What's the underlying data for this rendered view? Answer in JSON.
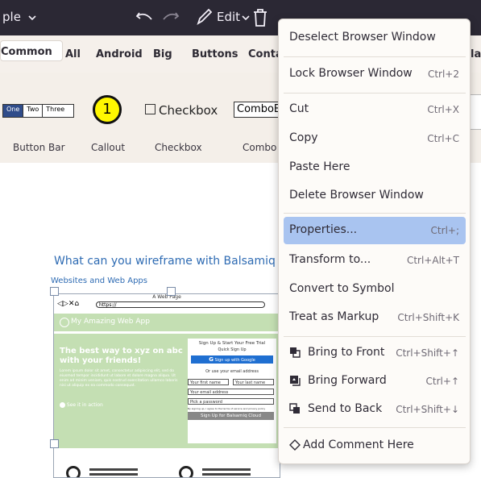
{
  "toolbar": {
    "project_name": "ple",
    "edit_label": "Edit"
  },
  "library_tabs": [
    "Common",
    "All",
    "Android",
    "Big",
    "Buttons",
    "Conta",
    "lar"
  ],
  "components": {
    "button_bar": {
      "label": "Button Bar",
      "segments": [
        "One",
        "Two",
        "Three"
      ]
    },
    "callout": {
      "label": "Callout",
      "number": "1"
    },
    "checkbox": {
      "label": "Checkbox",
      "text": "Checkbox"
    },
    "combo": {
      "label": "Combo",
      "text": "ComboB"
    }
  },
  "canvas": {
    "heading": "What can you wireframe with Balsamiq",
    "subheading": "Websites and Web Apps",
    "mock": {
      "title": "A Web Page",
      "url": "https://",
      "app_name": "My Amazing Web App",
      "hero_title": "The best way to xyz on abc with your friends!",
      "hero_body": "Lorem ipsum dolor sit amet, consectetur adipiscing elit, sed do eiusmod tempor incididunt ut labore et dolore magna aliqua. Ut enim ad minim veniam, quis nostrud exercitation ullamco laboris nisi ut aliquip ex ea commodo consequat.",
      "hero_link": "See it in action",
      "signup_title": "Sign Up & Start Your Free Trial",
      "quick_signup": "Quick Sign Up",
      "google_button": "Sign up with Google",
      "or_email": "Or use your email address",
      "first_name": "Your first name",
      "last_name": "Your last name",
      "email": "Your email address",
      "password": "Pick a password",
      "terms": "By signing up, I agree to the terms of service and privacy policy",
      "submit": "Sign Up for Balsamiq Cloud"
    }
  },
  "context_menu": {
    "deselect": "Deselect Browser Window",
    "lock": {
      "label": "Lock Browser Window",
      "shortcut": "Ctrl+2"
    },
    "cut": {
      "label": "Cut",
      "shortcut": "Ctrl+X"
    },
    "copy": {
      "label": "Copy",
      "shortcut": "Ctrl+C"
    },
    "paste": "Paste Here",
    "delete": "Delete Browser Window",
    "properties": {
      "label": "Properties...",
      "shortcut": "Ctrl+;"
    },
    "transform": {
      "label": "Transform to...",
      "shortcut": "Ctrl+Alt+T"
    },
    "convert": "Convert to Symbol",
    "markup": {
      "label": "Treat as Markup",
      "shortcut": "Ctrl+Shift+K"
    },
    "bring_front": {
      "label": "Bring to Front",
      "shortcut": "Ctrl+Shift+↑"
    },
    "bring_forward": {
      "label": "Bring Forward",
      "shortcut": "Ctrl+↑"
    },
    "send_back": {
      "label": "Send to Back",
      "shortcut": "Ctrl+Shift+↓"
    },
    "comment": "Add Comment Here"
  },
  "colors": {
    "toolbar_bg": "#2b2834",
    "menu_highlight": "#a9c4f0",
    "callout_fill": "#fff700",
    "hero_green": "#c4dfb3",
    "heading_blue": "#2e6bb3",
    "google_blue": "#1f6fd1"
  }
}
